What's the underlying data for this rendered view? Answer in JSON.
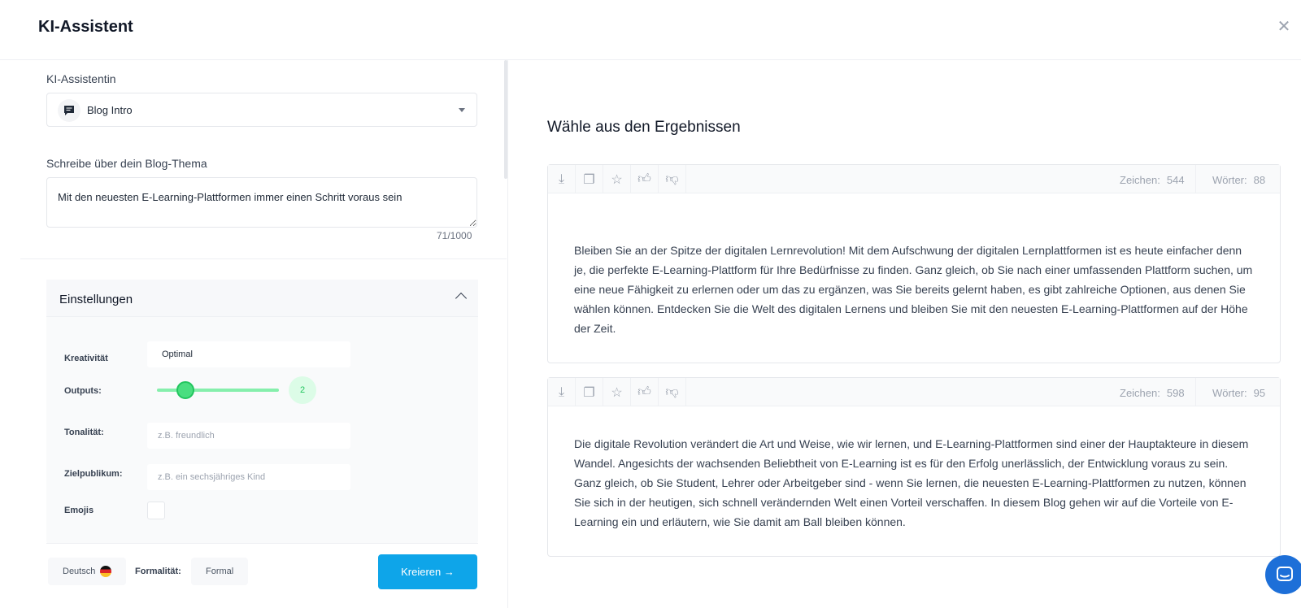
{
  "modal": {
    "title": "KI-Assistent"
  },
  "left": {
    "assistant_label": "KI-Assistentin",
    "assistant_value": "Blog Intro",
    "topic_label": "Schreibe über dein Blog-Thema",
    "topic_value": "Mit den neuesten E-Learning-Plattformen immer einen Schritt voraus sein",
    "counter": "71/1000"
  },
  "settings": {
    "title": "Einstellungen",
    "creativity_label": "Kreativität",
    "creativity_value": "Optimal",
    "outputs_label": "Outputs:",
    "outputs_value": "2",
    "tone_label": "Tonalität:",
    "tone_placeholder": "z.B. freundlich",
    "audience_label": "Zielpublikum:",
    "audience_placeholder": "z.B. ein sechsjähriges Kind",
    "emojis_label": "Emojis"
  },
  "footer": {
    "language": "Deutsch",
    "formality_label": "Formalität:",
    "formality_value": "Formal",
    "create_label": "Kreieren →"
  },
  "results": {
    "title": "Wähle aus den Ergebnissen",
    "chars_label": "Zeichen:",
    "words_label": "Wörter:",
    "items": [
      {
        "chars": "544",
        "words": "88",
        "text": "Bleiben Sie an der Spitze der digitalen Lernrevolution! Mit dem Aufschwung der digitalen Lernplattformen ist es heute einfacher denn je, die perfekte E-Learning-Plattform für Ihre Bedürfnisse zu finden. Ganz gleich, ob Sie nach einer umfassenden Plattform suchen, um eine neue Fähigkeit zu erlernen oder um das zu ergänzen, was Sie bereits gelernt haben, es gibt zahlreiche Optionen, aus denen Sie wählen können. Entdecken Sie die Welt des digitalen Lernens und bleiben Sie mit den neuesten E-Learning-Plattformen auf der Höhe der Zeit."
      },
      {
        "chars": "598",
        "words": "95",
        "text": "Die digitale Revolution verändert die Art und Weise, wie wir lernen, und E-Learning-Plattformen sind einer der Hauptakteure in diesem Wandel. Angesichts der wachsenden Beliebtheit von E-Learning ist es für den Erfolg unerlässlich, der Entwicklung voraus zu sein. Ganz gleich, ob Sie Student, Lehrer oder Arbeitgeber sind - wenn Sie lernen, die neuesten E-Learning-Plattformen zu nutzen, können Sie sich in der heutigen, sich schnell verändernden Welt einen Vorteil verschaffen. In diesem Blog gehen wir auf die Vorteile von E-Learning ein und erläutern, wie Sie damit am Ball bleiben können."
      }
    ]
  },
  "colors": {
    "accent": "#0ea5e9",
    "slider": "#4ade80",
    "chat": "#1d6fd8"
  }
}
